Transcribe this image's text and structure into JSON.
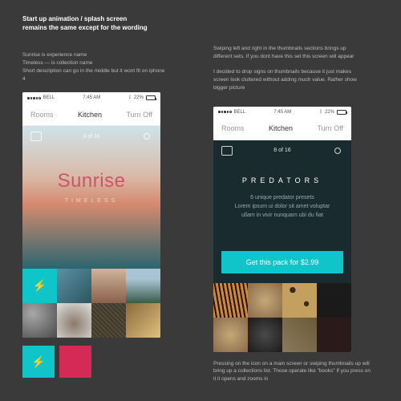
{
  "header": {
    "title_line1": "Start up animation / splash screen",
    "title_line2": "remains the same except for the wording"
  },
  "notes_left": "Sunrise is experience name\nTimeless — is collection name\nShort description can go in the middle but it wont fit on iphone 4",
  "notes_right_top": "Swiping left and right in the thumbnails sections brings up different sets. If you dont have this set this screen will appear\n\nI decided to drop signs on thumbnails because it just makes screen look cluttered without adding much value. Rather show bigger picture",
  "notes_bottom": "Pressing on the icon on a main screen or swiping thumbnails up will bring up a collections list. Those operate like \"books\" If you press on it it opens and zooms in",
  "statusbar": {
    "carrier": "BELL",
    "time": "7:45 AM",
    "battery_pct": "22%",
    "bt_icon": "bluetooth"
  },
  "topnav": {
    "left": "Rooms",
    "center": "Kitchen",
    "right": "Turn Off"
  },
  "screen1": {
    "counter": "3 of 16",
    "title": "Sunrise",
    "subtitle": "TIMELESS"
  },
  "screen2": {
    "counter": "8 of 16",
    "heading": "PREDATORS",
    "desc_l1": "6 unique predator presets",
    "desc_l2": "Lorem ipsum ui dolor sit amet voluptar ullam in vivir nunquam ubi du fiat",
    "cta": "Get this pack for $2.99"
  },
  "swatches": {
    "teal": "#0fc5c9",
    "red": "#d62a56",
    "bolt_icon": "lightning"
  }
}
